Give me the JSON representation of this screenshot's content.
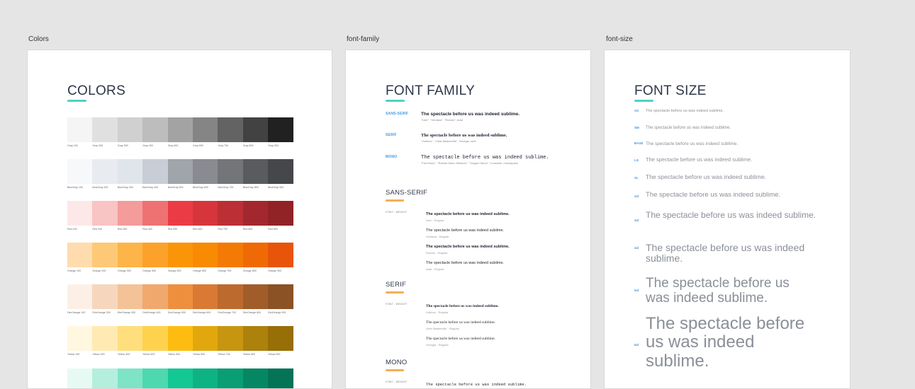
{
  "frames": {
    "colors_label": "Colors",
    "font_family_label": "font-family",
    "font_size_label": "font-size"
  },
  "colors": {
    "heading": "COLORS",
    "palettes": [
      {
        "labels": [
          "Gray 100",
          "Gray 200",
          "Gray 300",
          "Gray 400",
          "Gray 500",
          "Gray 600",
          "Gray 700",
          "Gray 800",
          "Gray 900"
        ],
        "hex": [
          "#f5f5f5",
          "#e0e0e0",
          "#d0d0d0",
          "#bdbdbd",
          "#a3a3a3",
          "#858585",
          "#636363",
          "#424242",
          "#212121"
        ]
      },
      {
        "labels": [
          "BlueGray 100",
          "BlueGray 200",
          "BlueGray 300",
          "BlueGray 400",
          "BlueGray 500",
          "BlueGray 600",
          "BlueGray 700",
          "BlueGray 800",
          "BlueGray 900"
        ],
        "hex": [
          "#f7f8fa",
          "#e8ebf0",
          "#e0e5ec",
          "#c9cdd5",
          "#a0a4ab",
          "#898b90",
          "#747579",
          "#5a5b5f",
          "#46474b"
        ]
      },
      {
        "labels": [
          "Red 100",
          "Red 200",
          "Red 300",
          "Red 400",
          "Red 500",
          "Red 600",
          "Red 700",
          "Red 800",
          "Red 900"
        ],
        "hex": [
          "#fde8e8",
          "#f8c4c4",
          "#f49b9b",
          "#ef7272",
          "#eb3c46",
          "#d6353c",
          "#bc2f35",
          "#a2282d",
          "#912327"
        ]
      },
      {
        "labels": [
          "Orange 100",
          "Orange 200",
          "Orange 300",
          "Orange 400",
          "Orange 500",
          "Orange 600",
          "Orange 700",
          "Orange 800",
          "Orange 900"
        ],
        "hex": [
          "#fedcad",
          "#fec977",
          "#fdb449",
          "#fca22a",
          "#fb9508",
          "#f88a04",
          "#f47a06",
          "#ef6a06",
          "#e8550a"
        ]
      },
      {
        "labels": [
          "DimOrange 100",
          "DimOrange 200",
          "DimOrange 300",
          "DimOrange 400",
          "DimOrange 500",
          "DimOrange 600",
          "DimOrange 700",
          "DimOrange 800",
          "DimOrange 900"
        ],
        "hex": [
          "#fcf0e6",
          "#f6d7be",
          "#f3c297",
          "#f0a86d",
          "#ee8f3d",
          "#d97933",
          "#bd6a2e",
          "#a05d2a",
          "#8a5225"
        ]
      },
      {
        "labels": [
          "Yellow 100",
          "Yellow 200",
          "Yellow 300",
          "Yellow 400",
          "Yellow 500",
          "Yellow 600",
          "Yellow 700",
          "Yellow 800",
          "Yellow 900"
        ],
        "hex": [
          "#fff7e0",
          "#ffeab3",
          "#ffde7d",
          "#ffd24d",
          "#fdbc0f",
          "#e2a70d",
          "#c79510",
          "#ac810c",
          "#986e06"
        ]
      },
      {
        "labels": [
          "",
          "",
          "",
          "",
          "",
          "",
          "",
          "",
          ""
        ],
        "hex": [
          "#e6faf3",
          "#b3efdc",
          "#7fe3c6",
          "#4dd8b0",
          "#14c895",
          "#0eb384",
          "#0a9e74",
          "#068763",
          "#047356"
        ]
      }
    ]
  },
  "font_family": {
    "heading": "FONT FAMILY",
    "families": [
      {
        "key": "SANS-SERIF",
        "sample": "The spectacle before us was indeed sublime.",
        "stack": "\"Inter\", \"Verdana\", \"Roboto\", Arial"
      },
      {
        "key": "SERIF",
        "sample": "The spectacle before us was indeed sublime.",
        "stack": "\"Volkhov\", \"Libre Baskerville\", Georgia, serif"
      },
      {
        "key": "MONO",
        "sample": "The spectacle before us was indeed sublime.",
        "stack": "\"Fira Mono\", \"Roboto Mono Medium\", \"Oxygen Mono\", Consolas, monospace"
      }
    ],
    "sections": [
      {
        "title": "SANS-SERIF",
        "label": "FONT - WEIGHT",
        "items": [
          {
            "sample": "The spectacle before us was indeed sublime.",
            "name": "Inter - Regular",
            "bold": true
          },
          {
            "sample": "The spectacle before us was indeed sublime.",
            "name": "Verdana - Regular",
            "bold": false
          },
          {
            "sample": "The spectacle before us was indeed sublime.",
            "name": "Roboto - Regular",
            "bold": true
          },
          {
            "sample": "The spectacle before us was indeed sublime.",
            "name": "Arial - Regular",
            "bold": false
          }
        ]
      },
      {
        "title": "SERIF",
        "label": "FONT - WEIGHT",
        "items": [
          {
            "sample": "The spectacle before us was indeed sublime.",
            "name": "Volkhov - Regular",
            "bold": true
          },
          {
            "sample": "The spectacle before us was indeed sublime.",
            "name": "Libre Baskerville - Regular",
            "bold": false
          },
          {
            "sample": "The spectacle before us was indeed sublime.",
            "name": "Georgia - Regular",
            "bold": false
          }
        ]
      },
      {
        "title": "MONO",
        "label": "FONT - WEIGHT",
        "items": [
          {
            "sample": "The spectacle before us was indeed sublime.",
            "name": "",
            "bold": false
          }
        ]
      }
    ]
  },
  "font_size": {
    "heading": "FONT SIZE",
    "sizes": [
      {
        "key": "XS",
        "text": "The spectacle before us was indeed sublime."
      },
      {
        "key": "SM",
        "text": "The spectacle before us was indeed sublime."
      },
      {
        "key": "BASE",
        "text": "The spectacle before us was indeed sublime."
      },
      {
        "key": "LG",
        "text": "The spectacle before us was indeed sublime."
      },
      {
        "key": "XL",
        "text": "The spectacle before us was indeed sublime."
      },
      {
        "key": "2xl",
        "text": "The spectacle before us was indeed sublime."
      },
      {
        "key": "3xl",
        "text": "The spectacle before us was indeed sublime."
      },
      {
        "key": "4xl",
        "text": "The spectacle before us was indeed sublime."
      },
      {
        "key": "5xl",
        "text": "The spectacle before us was indeed sublime."
      },
      {
        "key": "6xl",
        "text": "The spectacle before us was indeed sublime."
      }
    ]
  }
}
